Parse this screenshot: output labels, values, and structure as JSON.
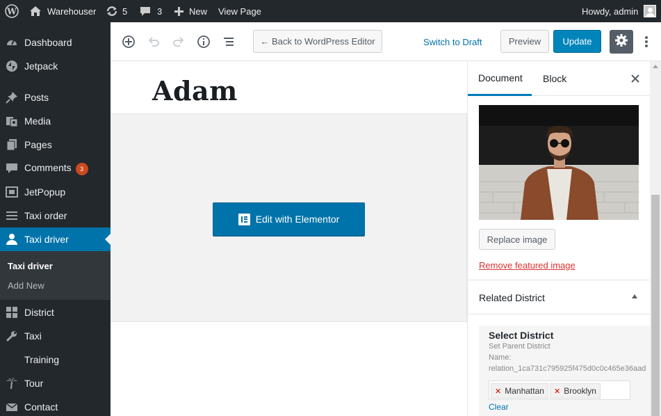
{
  "admin_bar": {
    "site_name": "Warehouser",
    "updates_count": "5",
    "comments_count": "3",
    "new_label": "New",
    "view_page_label": "View Page",
    "greeting": "Howdy, admin"
  },
  "sidebar": {
    "items": [
      {
        "label": "Dashboard",
        "icon": "dashboard-icon"
      },
      {
        "label": "Jetpack",
        "icon": "jetpack-icon"
      },
      {
        "label": "Posts",
        "icon": "pin-icon"
      },
      {
        "label": "Media",
        "icon": "media-icon"
      },
      {
        "label": "Pages",
        "icon": "pages-icon"
      },
      {
        "label": "Comments",
        "icon": "comments-icon",
        "badge": "3"
      },
      {
        "label": "JetPopup",
        "icon": "popup-icon"
      },
      {
        "label": "Taxi order",
        "icon": "list-icon"
      },
      {
        "label": "Taxi driver",
        "icon": "user-icon",
        "active": true
      },
      {
        "label": "District",
        "icon": "grid-icon"
      },
      {
        "label": "Taxi",
        "icon": "wrench-icon"
      },
      {
        "label": "Training",
        "icon": ""
      },
      {
        "label": "Tour",
        "icon": "palm-icon"
      },
      {
        "label": "Contact",
        "icon": "mail-icon"
      }
    ],
    "submenu": [
      {
        "label": "Taxi driver",
        "current": true
      },
      {
        "label": "Add New",
        "current": false
      }
    ]
  },
  "toolbar": {
    "back_label": "← Back to WordPress Editor",
    "switch_draft_label": "Switch to Draft",
    "preview_label": "Preview",
    "update_label": "Update"
  },
  "editor": {
    "post_title": "Adam",
    "elementor_button_label": "Edit with Elementor"
  },
  "panel": {
    "tabs": [
      {
        "label": "Document",
        "active": true
      },
      {
        "label": "Block",
        "active": false
      }
    ],
    "replace_image_label": "Replace image",
    "remove_featured_label": "Remove featured image",
    "related_section_title": "Related District",
    "select_label": "Select District",
    "select_desc_1": "Set Parent District",
    "select_desc_2": "Name:",
    "select_desc_3": "relation_1ca731c795925f475d0c0c465e36aad",
    "selected_chips": [
      "Manhattan",
      "Brooklyn"
    ],
    "clear_label": "Clear"
  },
  "colors": {
    "admin_dark": "#23282d",
    "accent_blue": "#0073aa",
    "primary_button": "#0085ba",
    "badge_orange": "#ca4a1f",
    "danger_red": "#dc3232"
  }
}
